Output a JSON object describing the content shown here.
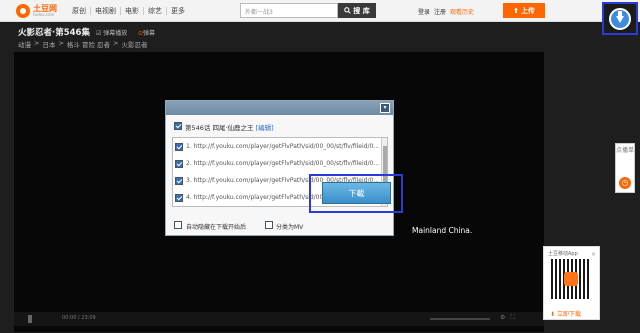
{
  "header": {
    "logo_text": "土豆网",
    "logo_sub": "tudou.com",
    "nav": [
      "原创",
      "电视剧",
      "电影",
      "综艺",
      "更多"
    ],
    "search_placeholder": "外都一战3",
    "search_button": "搜 库",
    "login": "登录",
    "register": "注册",
    "history": "观看历史",
    "upload": "上传"
  },
  "title_strip": {
    "title": "火影忍者·第546集",
    "opt_autoplay": "弹幕播放",
    "opt_danmu": "弹幕",
    "crumbs": [
      "动漫",
      ">",
      "日本",
      ">",
      "格斗 冒险 忍者",
      ">",
      "火影忍者"
    ]
  },
  "player": {
    "subtitle": "Mainland China.",
    "time": "00:00 / 23:09"
  },
  "side_float": {
    "label": "点播单"
  },
  "promo": {
    "title": "土豆移动App",
    "close": "×",
    "download": "立即下载"
  },
  "dialog": {
    "collapse_icon": "▾",
    "episode_label": "第546话 四尾·仙鹿之王",
    "edit_label": "[编辑]",
    "items": [
      "1. http://f.youku.com/player/getFlvPath/sid/00_00/st/flv/fileid/0...",
      "2. http://f.youku.com/player/getFlvPath/sid/00_00/st/flv/fileid/0...",
      "3. http://f.youku.com/player/getFlvPath/sid/00_00/st/flv/fileid/0...",
      "4. http://f.youku.com/player/getFlvPath/sid/00_00/st/flv/fileid/0..."
    ],
    "option_auto_hide": "自动隐藏在下载开始后",
    "option_mv": "分类为MV",
    "download_button": "下載"
  }
}
